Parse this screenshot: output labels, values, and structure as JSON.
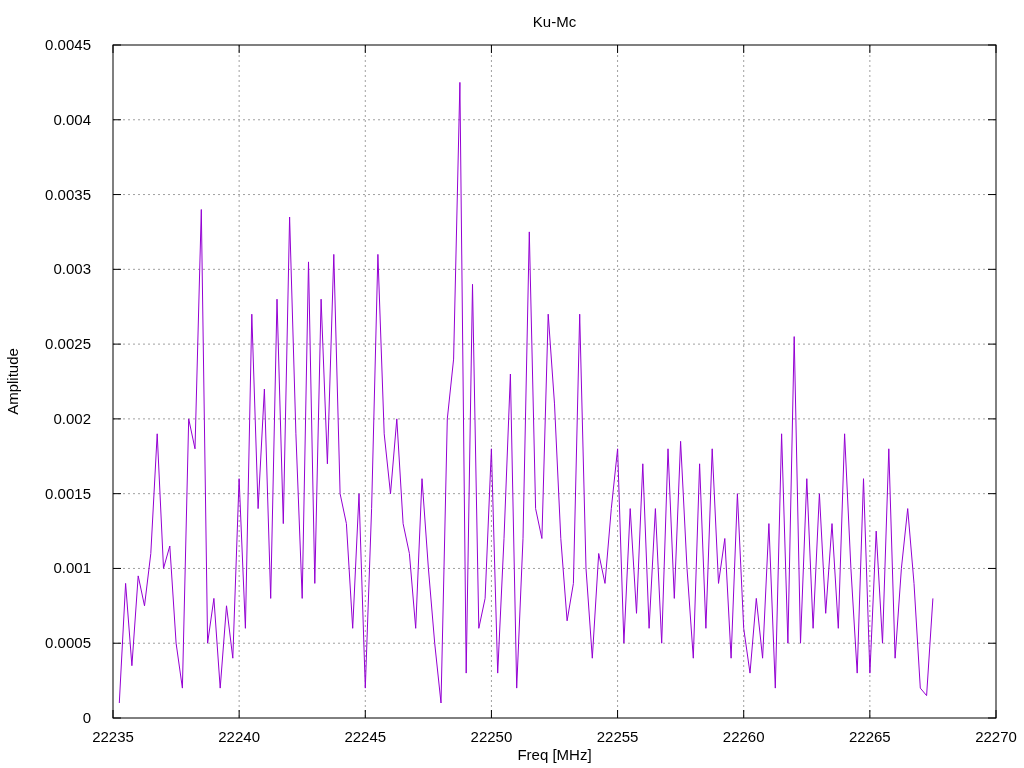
{
  "chart_data": {
    "type": "line",
    "title": "Ku-Mc",
    "xlabel": "Freq [MHz]",
    "ylabel": "Amplitude",
    "grid": true,
    "xlim": [
      22235,
      22270
    ],
    "ylim": [
      0,
      0.0045
    ],
    "xticks": [
      22235,
      22240,
      22245,
      22250,
      22255,
      22260,
      22265,
      22270
    ],
    "yticks": [
      {
        "value": 0,
        "label": "0"
      },
      {
        "value": 0.0005,
        "label": "0.0005"
      },
      {
        "value": 0.001,
        "label": "0.001"
      },
      {
        "value": 0.0015,
        "label": "0.0015"
      },
      {
        "value": 0.002,
        "label": "0.002"
      },
      {
        "value": 0.0025,
        "label": "0.0025"
      },
      {
        "value": 0.003,
        "label": "0.003"
      },
      {
        "value": 0.0035,
        "label": "0.0035"
      },
      {
        "value": 0.004,
        "label": "0.004"
      },
      {
        "value": 0.0045,
        "label": "0.0045"
      }
    ],
    "x": [
      22235.25,
      22235.5,
      22235.75,
      22236,
      22236.25,
      22236.5,
      22236.75,
      22237,
      22237.25,
      22237.5,
      22237.75,
      22238,
      22238.25,
      22238.5,
      22238.75,
      22239,
      22239.25,
      22239.5,
      22239.75,
      22240,
      22240.25,
      22240.5,
      22240.75,
      22241,
      22241.25,
      22241.5,
      22241.75,
      22242,
      22242.25,
      22242.5,
      22242.75,
      22243,
      22243.25,
      22243.5,
      22243.75,
      22244,
      22244.25,
      22244.5,
      22244.75,
      22245,
      22245.25,
      22245.5,
      22245.75,
      22246,
      22246.25,
      22246.5,
      22246.75,
      22247,
      22247.25,
      22247.5,
      22247.75,
      22248,
      22248.25,
      22248.5,
      22248.75,
      22249,
      22249.25,
      22249.5,
      22249.75,
      22250,
      22250.25,
      22250.5,
      22250.75,
      22251,
      22251.25,
      22251.5,
      22251.75,
      22252,
      22252.25,
      22252.5,
      22252.75,
      22253,
      22253.25,
      22253.5,
      22253.75,
      22254,
      22254.25,
      22254.5,
      22254.75,
      22255,
      22255.25,
      22255.5,
      22255.75,
      22256,
      22256.25,
      22256.5,
      22256.75,
      22257,
      22257.25,
      22257.5,
      22257.75,
      22258,
      22258.25,
      22258.5,
      22258.75,
      22259,
      22259.25,
      22259.5,
      22259.75,
      22260,
      22260.25,
      22260.5,
      22260.75,
      22261,
      22261.25,
      22261.5,
      22261.75,
      22262,
      22262.25,
      22262.5,
      22262.75,
      22263,
      22263.25,
      22263.5,
      22263.75,
      22264,
      22264.25,
      22264.5,
      22264.75,
      22265,
      22265.25,
      22265.5,
      22265.75,
      22266,
      22266.25,
      22266.5,
      22266.75,
      22267,
      22267.25,
      22267.5
    ],
    "series": [
      {
        "color": "#9400d3",
        "values": [
          0.0001,
          0.0009,
          0.00035,
          0.00095,
          0.00075,
          0.0011,
          0.0019,
          0.001,
          0.00115,
          0.0005,
          0.0002,
          0.002,
          0.0018,
          0.0034,
          0.0005,
          0.0008,
          0.0002,
          0.00075,
          0.0004,
          0.0016,
          0.0006,
          0.0027,
          0.0014,
          0.0022,
          0.0008,
          0.0028,
          0.0013,
          0.00335,
          0.0019,
          0.0008,
          0.00305,
          0.0009,
          0.0028,
          0.0017,
          0.0031,
          0.0015,
          0.0013,
          0.0006,
          0.0015,
          0.0002,
          0.0014,
          0.0031,
          0.0019,
          0.0015,
          0.002,
          0.0013,
          0.0011,
          0.0006,
          0.0016,
          0.001,
          0.0005,
          0.0001,
          0.002,
          0.0024,
          0.00425,
          0.0003,
          0.0029,
          0.0006,
          0.0008,
          0.0018,
          0.0003,
          0.0012,
          0.0023,
          0.0002,
          0.0012,
          0.00325,
          0.0014,
          0.0012,
          0.0027,
          0.0021,
          0.0012,
          0.00065,
          0.0009,
          0.0027,
          0.001,
          0.0004,
          0.0011,
          0.0009,
          0.0014,
          0.0018,
          0.0005,
          0.0014,
          0.0007,
          0.0017,
          0.0006,
          0.0014,
          0.0005,
          0.0018,
          0.0008,
          0.00185,
          0.001,
          0.0004,
          0.0017,
          0.0006,
          0.0018,
          0.0009,
          0.0012,
          0.0004,
          0.0015,
          0.0006,
          0.0003,
          0.0008,
          0.0004,
          0.0013,
          0.0002,
          0.0019,
          0.0005,
          0.00255,
          0.0005,
          0.0016,
          0.0006,
          0.0015,
          0.0007,
          0.0013,
          0.0006,
          0.0019,
          0.001,
          0.0003,
          0.0016,
          0.0003,
          0.00125,
          0.0005,
          0.0018,
          0.0004,
          0.001,
          0.0014,
          0.0009,
          0.0002,
          0.00015,
          0.0008
        ]
      }
    ]
  }
}
